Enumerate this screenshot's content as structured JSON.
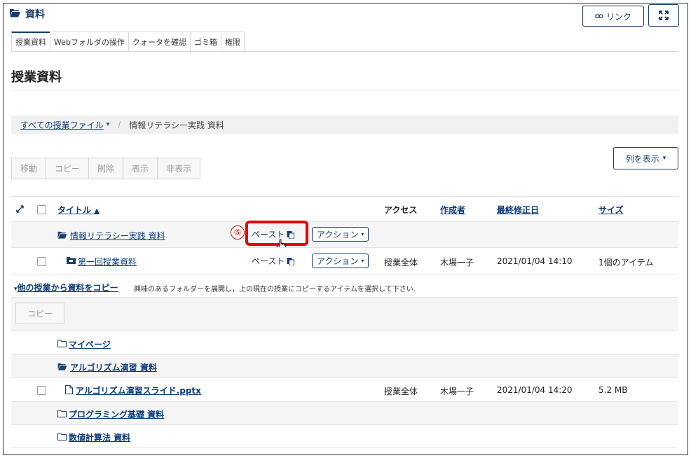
{
  "header": {
    "title": "資料",
    "link_button": "リンク"
  },
  "tabs": [
    {
      "label": "授業資料"
    },
    {
      "label": "Webフォルダの操作"
    },
    {
      "label": "クォータを確認"
    },
    {
      "label": "ゴミ箱"
    },
    {
      "label": "権限"
    }
  ],
  "page_title": "授業資料",
  "breadcrumb": {
    "root": "すべての授業ファイル",
    "current": "情報リテラシー実践 資料"
  },
  "toolbar": {
    "move": "移動",
    "copy": "コピー",
    "delete": "削除",
    "show": "表示",
    "hide": "非表示",
    "columns_button": "列を表示"
  },
  "table": {
    "headers": {
      "title": "タイトル",
      "access": "アクセス",
      "author": "作成者",
      "modified": "最終修正日",
      "size": "サイズ"
    },
    "rows": [
      {
        "title": "情報リテラシー実践 資料",
        "paste": "ペースト",
        "action": "アクション"
      },
      {
        "title": "第一回授業資料",
        "paste": "ペースト",
        "action": "アクション",
        "access": "授業全体",
        "author": "木場一子",
        "modified": "2021/01/04 14:10",
        "size": "1個のアイテム"
      }
    ]
  },
  "step_marker": "⑤",
  "copy_section": {
    "toggle": "他の授業から資料をコピー",
    "description": "興味のあるフォルダーを展開し，上の現在の授業にコピーするアイテムを選択して下さい.",
    "copy_button": "コピー",
    "items": [
      {
        "title": "マイページ"
      },
      {
        "title": "アルゴリズム演習 資料"
      },
      {
        "title": "アルゴリズム演習スライド.pptx",
        "access": "授業全体",
        "author": "木場一子",
        "modified": "2021/01/04 14:20",
        "size": "5.2 MB"
      },
      {
        "title": "プログラミング基礎 資料"
      },
      {
        "title": "数値計算法 資料"
      }
    ]
  },
  "colors": {
    "accent": "#1a3e6b",
    "highlight": "#e60000"
  }
}
